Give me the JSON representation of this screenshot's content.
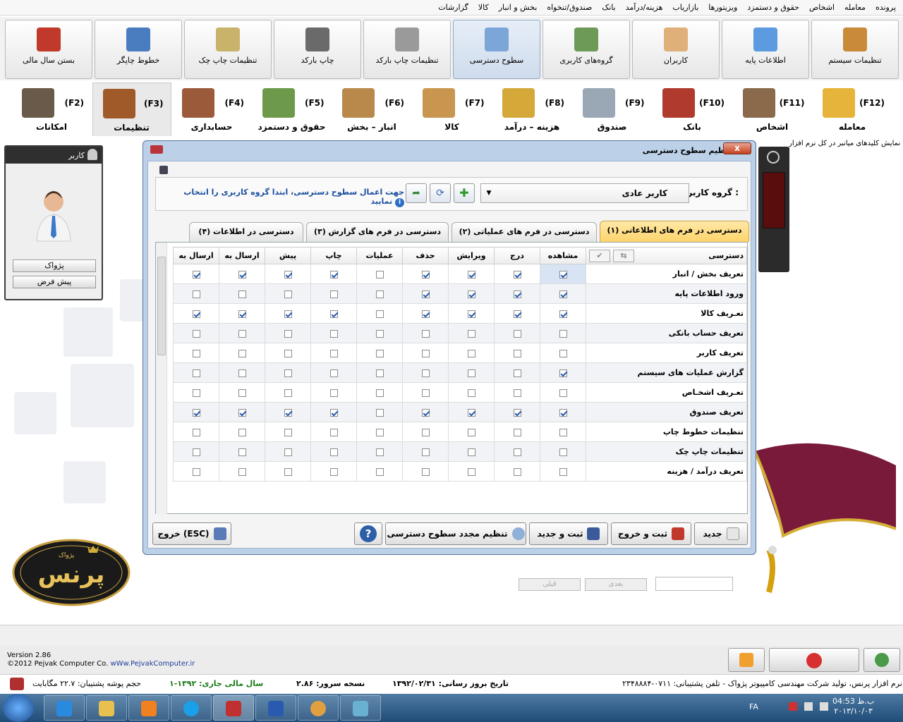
{
  "menubar": [
    "پرونده",
    "معامله",
    "اشخاص",
    "حقوق و دستمزد",
    "ویزیتورها",
    "بازاریاب",
    "هزینه/درآمد",
    "بانک",
    "صندوق/تنخواه",
    "بخش و انبار",
    "کالا",
    "گزارشات"
  ],
  "toolbar": [
    {
      "label": "تنظیمات سیستم",
      "icon": "tools-icon",
      "color": "#c98a3a"
    },
    {
      "label": "اطلاعات پایه",
      "icon": "cubes-icon",
      "color": "#5d9be0"
    },
    {
      "label": "کاربران",
      "icon": "user-icon",
      "color": "#e0b07a"
    },
    {
      "label": "گروه‌های کاربری",
      "icon": "users-group-icon",
      "color": "#6e9a58"
    },
    {
      "label": "سطوح دسترسی",
      "icon": "access-levels-icon",
      "color": "#7ca6d8",
      "selected": true
    },
    {
      "label": "تنظیمات چاپ بارکد",
      "icon": "barcode-settings-icon",
      "color": "#9a9a9a"
    },
    {
      "label": "چاپ بارکد",
      "icon": "barcode-icon",
      "color": "#6a6a6a"
    },
    {
      "label": "تنظیمات چاپ چک",
      "icon": "cheque-settings-icon",
      "color": "#c9b36b"
    },
    {
      "label": "خطوط چاپگر",
      "icon": "printer-icon",
      "color": "#4a7cc0"
    },
    {
      "label": "بستن سال مالی",
      "icon": "close-year-icon",
      "color": "#c0392b"
    }
  ],
  "fkeys": [
    {
      "key": "(F12)",
      "label": "معامله",
      "icon": "basket-icon",
      "color": "#e6b43a"
    },
    {
      "key": "(F11)",
      "label": "اشخاص",
      "icon": "person-icon",
      "color": "#8a6a4a"
    },
    {
      "key": "(F10)",
      "label": "بانک",
      "icon": "bank-icon",
      "color": "#b03a2e"
    },
    {
      "key": "(F9)",
      "label": "صندوق",
      "icon": "cash-register-icon",
      "color": "#9aa7b5"
    },
    {
      "key": "(F8)",
      "label": "هزینه – درآمد",
      "icon": "money-icon",
      "color": "#d4a93a"
    },
    {
      "key": "(F7)",
      "label": "کالا",
      "icon": "box-icon",
      "color": "#c8964e"
    },
    {
      "key": "(F6)",
      "label": "انبار – بخش",
      "icon": "warehouse-icon",
      "color": "#b8894a"
    },
    {
      "key": "(F5)",
      "label": "حقوق و دستمزد",
      "icon": "salary-icon",
      "color": "#6c9a4a"
    },
    {
      "key": "(F4)",
      "label": "حسابداری",
      "icon": "calculator-icon",
      "color": "#9b5a3a"
    },
    {
      "key": "(F3)",
      "label": "تنظیمات",
      "icon": "settings-tools-icon",
      "color": "#a05a2a",
      "selected": true
    },
    {
      "key": "(F2)",
      "label": "امکانات",
      "icon": "ruler-tools-icon",
      "color": "#6a5a4a"
    }
  ],
  "user_panel": {
    "title": "کاربر",
    "btn1": "پژواک",
    "btn2": "پیش فرض"
  },
  "hint": "برای نمایش کلیدهای میانبر در کل نرم افزار",
  "dialog": {
    "title": "تنظیم سطوح دسترسی",
    "close": "x",
    "group_label": "گروه کاربری :",
    "group_value": "کاربر عادی",
    "info": "جهت اعمال سطوح دسترسی، ابتدا گروه کاربری را انتخاب نمایید",
    "tabs": [
      "دسترسی در فرم های اطلاعاتی (۱)",
      "دسترسی در فرم های عملیاتی (۲)",
      "دسترسی در فرم های گزارش (۳)",
      "دسترسی در اطلاعات (۴)"
    ],
    "columns": [
      "دسترسی",
      "مشاهده",
      "درج",
      "ویرایش",
      "حذف",
      "عملیات",
      "چاپ",
      "پیش",
      "ارسال به",
      "ارسال به"
    ],
    "rows": [
      {
        "name": "تعریف بخش / انبار",
        "v": [
          1,
          1,
          1,
          1,
          0,
          1,
          1,
          1,
          1
        ]
      },
      {
        "name": "ورود اطلاعات پایه",
        "v": [
          1,
          1,
          1,
          1,
          0,
          0,
          0,
          0,
          0
        ]
      },
      {
        "name": "تعـریف کالا",
        "v": [
          1,
          1,
          1,
          1,
          0,
          1,
          1,
          1,
          1
        ]
      },
      {
        "name": "تعریف حساب بانکی",
        "v": [
          0,
          0,
          0,
          0,
          0,
          0,
          0,
          0,
          0
        ]
      },
      {
        "name": "تعریف کاربر",
        "v": [
          0,
          0,
          0,
          0,
          0,
          0,
          0,
          0,
          0
        ]
      },
      {
        "name": "گزارش عملیات های سیستم",
        "v": [
          1,
          0,
          0,
          0,
          0,
          0,
          0,
          0,
          0
        ]
      },
      {
        "name": "تعـریف اشخـاص",
        "v": [
          0,
          0,
          0,
          0,
          0,
          0,
          0,
          0,
          0
        ]
      },
      {
        "name": "تعریف صندوق",
        "v": [
          1,
          1,
          1,
          1,
          0,
          1,
          1,
          1,
          1
        ]
      },
      {
        "name": "تنظیمات خطوط چاپ",
        "v": [
          0,
          0,
          0,
          0,
          0,
          0,
          0,
          0,
          0
        ]
      },
      {
        "name": "تنظیمات چاپ چک",
        "v": [
          0,
          0,
          0,
          0,
          0,
          0,
          0,
          0,
          0
        ]
      },
      {
        "name": "تعریف درآمد / هزینه",
        "v": [
          0,
          0,
          0,
          0,
          0,
          0,
          0,
          0,
          0
        ]
      }
    ],
    "pager_next": "بعدی",
    "pager_prev": "قبلی",
    "buttons": {
      "new": "جدید",
      "save_exit": "ثبت و خروج",
      "save_new": "ثبت و جدید",
      "reset": "تنظیم مجدد سطوح دسترسی",
      "help": "?",
      "exit": "خروج (ESC)"
    }
  },
  "status": {
    "version": "Version 2.86",
    "copyright": "©2012 Pejvak Computer Co.",
    "website": "wWw.PejvakComputer.ir",
    "backup": "حجم پوشه پشتیبان: ۲۲.۷ مگابایت",
    "fiscal_year": "سال مالی جاری: ۱۳۹۲-۱",
    "server": "نسخه سرور: ۲.۸۶",
    "update": "تاریخ بروز رسانی: ۱۳۹۲/۰۲/۳۱",
    "company": "نرم افزار پرنس، تولید شرکت مهندسی کامپیوتر پژواک - تلفن پشتیبانی: ۰۷۱۱-۲۳۴۸۸۸۴"
  },
  "taskbar": {
    "lang": "FA",
    "time": "04:53 ب.ظ",
    "date": "۲۰۱۳/۱۰/۰۳"
  },
  "logo_text": "پرنس",
  "logo_sub": "پژواک"
}
